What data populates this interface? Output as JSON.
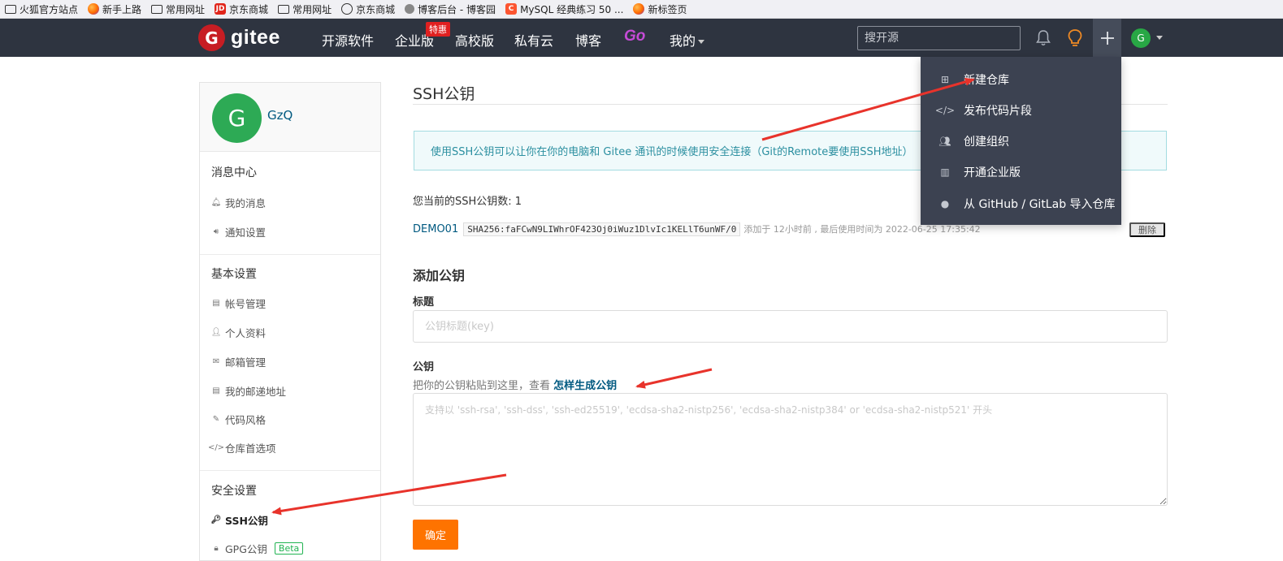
{
  "bookmarks": [
    {
      "icon": "folder-icon",
      "label": "火狐官方站点"
    },
    {
      "icon": "firefox-icon",
      "label": "新手上路"
    },
    {
      "icon": "folder-icon",
      "label": "常用网址"
    },
    {
      "icon": "jd-icon",
      "label": "京东商城"
    },
    {
      "icon": "folder-icon",
      "label": "常用网址"
    },
    {
      "icon": "globe-icon",
      "label": "京东商城"
    },
    {
      "icon": "cnblogs-icon",
      "label": "博客后台 - 博客园"
    },
    {
      "icon": "csdn-icon",
      "label": "MySQL 经典练习 50 ..."
    },
    {
      "icon": "firefox-icon",
      "label": "新标签页"
    }
  ],
  "nav": {
    "logo_mark": "G",
    "logo_text": "gitee",
    "links": [
      "开源软件",
      "企业版",
      "高校版",
      "私有云",
      "博客"
    ],
    "hot_badge": "特惠",
    "go_label": "Go",
    "mine_label": "我的",
    "search_placeholder": "搜开源",
    "avatar_letter": "G"
  },
  "dropdown": {
    "items": [
      {
        "icon": "plus-square-icon",
        "label": "新建仓库"
      },
      {
        "icon": "code-icon",
        "label": "发布代码片段"
      },
      {
        "icon": "users-icon",
        "label": "创建组织"
      },
      {
        "icon": "building-icon",
        "label": "开通企业版"
      },
      {
        "icon": "github-icon",
        "label": "从 GitHub / GitLab 导入仓库"
      }
    ]
  },
  "sidebar": {
    "avatar_letter": "G",
    "username": "GzQ",
    "sections": [
      {
        "title": "消息中心",
        "items": [
          {
            "icon": "bell-icon",
            "label": "我的消息"
          },
          {
            "icon": "volume-icon",
            "label": "通知设置"
          }
        ]
      },
      {
        "title": "基本设置",
        "items": [
          {
            "icon": "idcard-icon",
            "label": "帐号管理"
          },
          {
            "icon": "user-icon",
            "label": "个人资料"
          },
          {
            "icon": "mail-icon",
            "label": "邮箱管理"
          },
          {
            "icon": "idcard-icon",
            "label": "我的邮递地址"
          },
          {
            "icon": "brush-icon",
            "label": "代码风格"
          },
          {
            "icon": "code-icon",
            "label": "仓库首选项"
          }
        ]
      },
      {
        "title": "安全设置",
        "items": [
          {
            "icon": "key-icon",
            "label": "SSH公钥"
          },
          {
            "icon": "lock-icon",
            "label": "GPG公钥",
            "badge": "Beta"
          }
        ]
      }
    ]
  },
  "main": {
    "title": "SSH公钥",
    "info": "使用SSH公钥可以让你在你的电脑和 Gitee 通讯的时候使用安全连接（Git的Remote要使用SSH地址）",
    "count_text": "您当前的SSH公钥数: 1",
    "key": {
      "name": "DEMO01",
      "fingerprint": "SHA256:faFCwN9LIWhrOF423Oj0iWuz1DlvIc1KELlT6unWF/0",
      "meta": "添加于 12小时前 , 最后使用时间为 2022-06-25 17:35:42",
      "delete_label": "删除"
    },
    "add_title": "添加公钥",
    "title_label": "标题",
    "title_placeholder": "公钥标题(key)",
    "key_label": "公钥",
    "hint_prefix": "把你的公钥粘贴到这里，查看",
    "hint_link": "怎样生成公钥",
    "key_placeholder": "支持以 'ssh-rsa', 'ssh-dss', 'ssh-ed25519', 'ecdsa-sha2-nistp256', 'ecdsa-sha2-nistp384' or 'ecdsa-sha2-nistp521' 开头",
    "submit_label": "确定"
  },
  "colors": {
    "nav_bg": "#2e3440",
    "brand_red": "#c71d23",
    "accent_orange": "#fe7300",
    "link_blue": "#005980",
    "annotation_red": "#e8332b"
  }
}
